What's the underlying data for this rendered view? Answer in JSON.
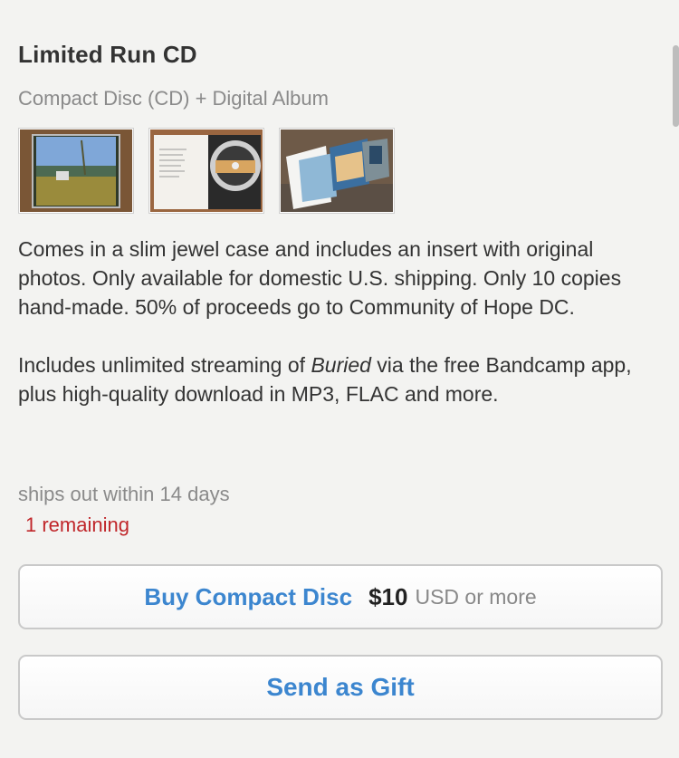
{
  "product": {
    "title": "Limited Run CD",
    "format": "Compact Disc (CD) + Digital Album",
    "thumbnails": [
      {
        "name": "jewel-case-front-photo"
      },
      {
        "name": "open-case-with-disc-photo"
      },
      {
        "name": "insert-photo"
      }
    ],
    "description": {
      "p1": "Comes in a slim jewel case and includes an insert with original photos. Only available for domestic U.S. shipping. Only 10 copies hand-made. 50% of proceeds go to Community of Hope DC.",
      "p2_before": "Includes unlimited streaming of ",
      "p2_italic": "Buried",
      "p2_after": " via the free Bandcamp app, plus high-quality download in MP3, FLAC and more."
    },
    "ships": "ships out within 14 days",
    "remaining": "1 remaining"
  },
  "buttons": {
    "buy_label": "Buy Compact Disc",
    "price": "$10",
    "currency": "USD or more",
    "gift_label": "Send as Gift"
  },
  "colors": {
    "accent": "#3c86cf",
    "remaining": "#c0262a",
    "muted": "#8a8a8a",
    "background": "#f3f3f1"
  }
}
